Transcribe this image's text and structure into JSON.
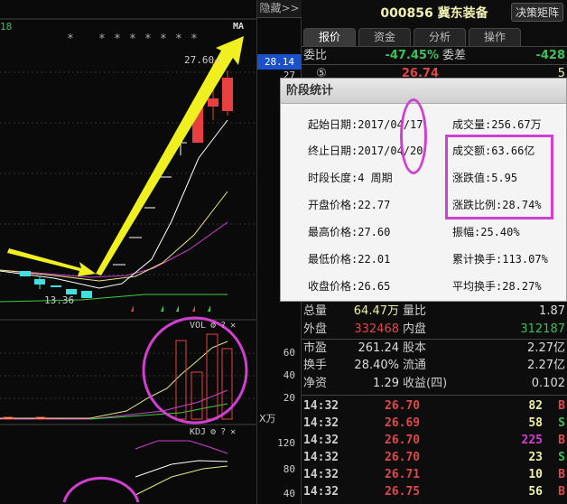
{
  "chart": {
    "top_left_value": "18",
    "ma_label": "MA",
    "asterisks": [
      "*",
      "*",
      "*",
      "*",
      "*",
      "*",
      "*",
      "*"
    ],
    "high_label": "27.60→",
    "low_label": "13.36",
    "vol_label": "VOL",
    "kdj_label": "KDJ",
    "help": "?",
    "close": "✕"
  },
  "axis": {
    "hide_label": "隐藏>>",
    "current_price": "28.14",
    "price_partial": "27",
    "vol_ticks": [
      "60",
      "40",
      "20"
    ],
    "vol_unit": "X万",
    "kdj_ticks": [
      "120",
      "80",
      "40"
    ]
  },
  "header": {
    "code_name": "000856 冀东装备",
    "decision_button": "决策矩阵"
  },
  "tabs": [
    "报价",
    "资金",
    "分析",
    "操作"
  ],
  "quote": {
    "weibi_label": "委比",
    "weibi_value": "-47.45%",
    "weicha_label": "委差",
    "weicha_value": "-428",
    "level_marker": "⑤",
    "level_price": "26.74",
    "level_vol": "5"
  },
  "stats": [
    {
      "l1": "总量",
      "v1": "64.47万",
      "l2": "量比",
      "v2": "1.87"
    },
    {
      "l1": "外盘",
      "v1": "332468",
      "l2": "内盘",
      "v2": "312187"
    },
    {
      "l1": "市盈",
      "v1": "261.24",
      "l2": "股本",
      "v2": "2.27亿"
    },
    {
      "l1": "换手",
      "v1": "28.40%",
      "l2": "流通",
      "v2": "2.27亿"
    },
    {
      "l1": "净资",
      "v1": "1.29",
      "l2": "收益(四)",
      "v2": "0.102"
    }
  ],
  "ticks": [
    {
      "time": "14:32",
      "price": "26.70",
      "vol": "82",
      "side": "B"
    },
    {
      "time": "14:32",
      "price": "26.69",
      "vol": "58",
      "side": "S"
    },
    {
      "time": "14:32",
      "price": "26.70",
      "vol": "225",
      "side": "B"
    },
    {
      "time": "14:32",
      "price": "26.70",
      "vol": "23",
      "side": "S"
    },
    {
      "time": "14:32",
      "price": "26.71",
      "vol": "10",
      "side": "B"
    },
    {
      "time": "14:32",
      "price": "26.75",
      "vol": "56",
      "side": "B"
    }
  ],
  "popup": {
    "title": "阶段统计",
    "left": [
      "起始日期:2017/04/17",
      "终止日期:2017/04/20",
      "时段长度:4 周期",
      "开盘价格:22.77",
      "最高价格:27.60",
      "最低价格:22.01",
      "收盘价格:26.65"
    ],
    "right": [
      "成交量:256.67万",
      "成交额:63.66亿",
      "涨跌值:5.95",
      "涨跌比例:28.74%",
      "振幅:25.40%",
      "累计换手:113.07%",
      "平均换手:28.27%"
    ]
  },
  "colors": {
    "up": "#e84040",
    "down": "#40e0e0",
    "highlight": "#d040d0",
    "arrow": "#f0f020"
  }
}
